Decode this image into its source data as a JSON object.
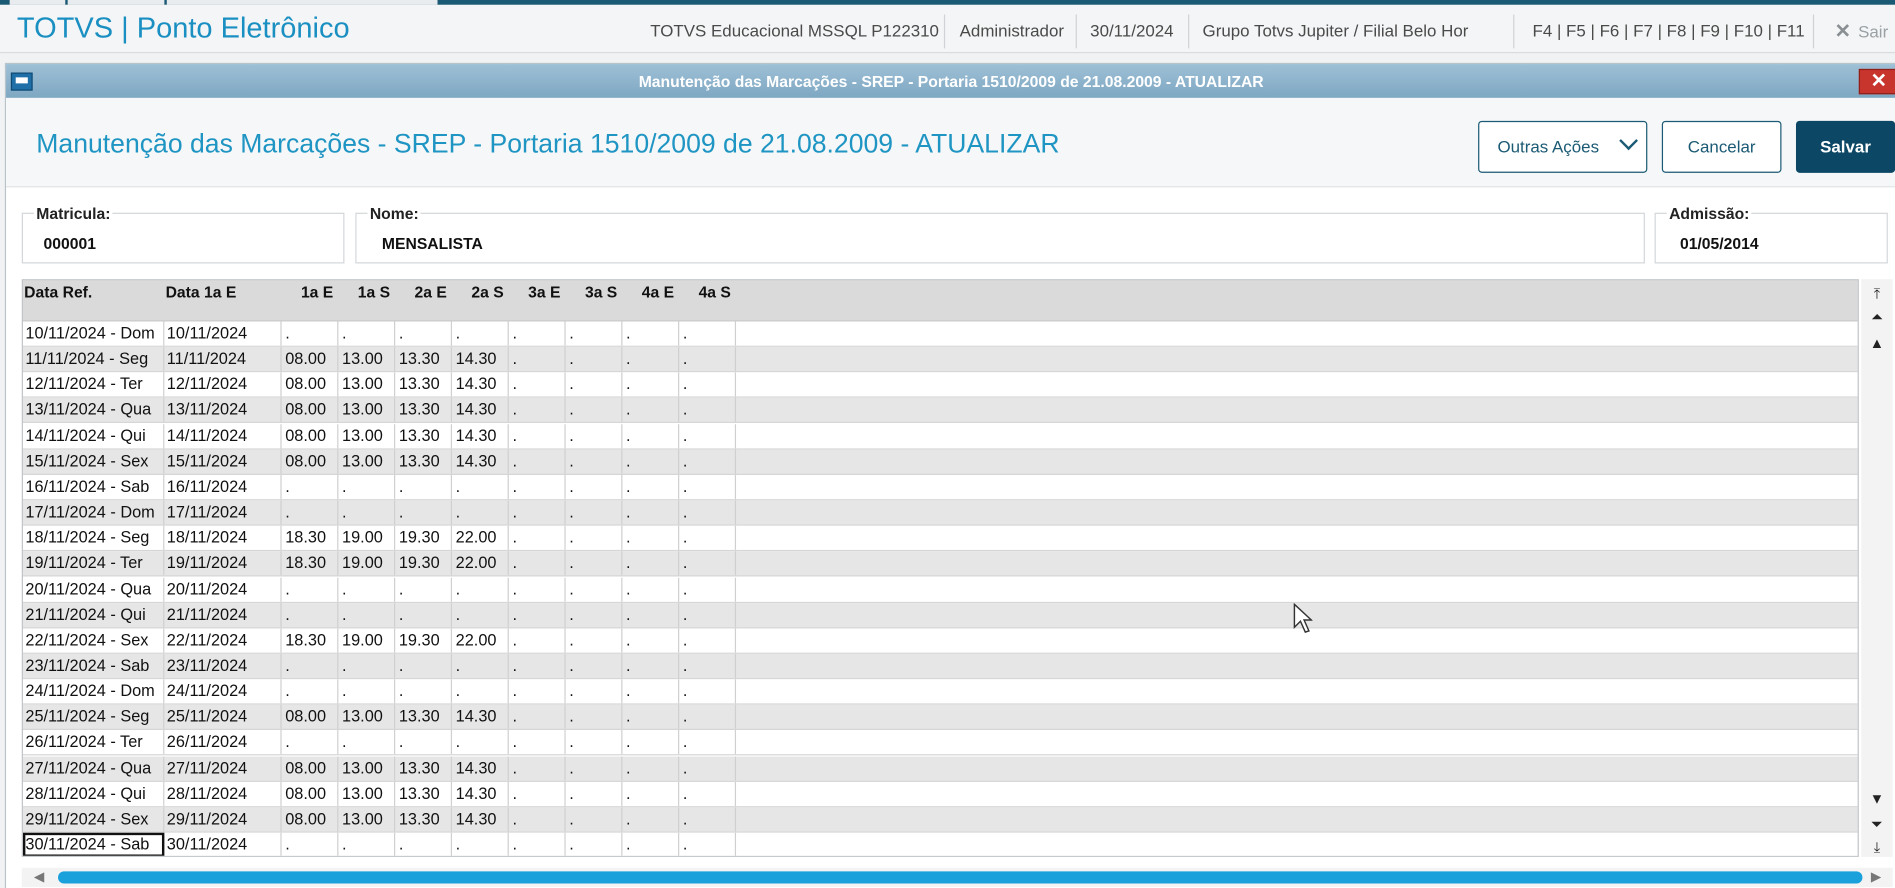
{
  "app": {
    "title": "TOTVS | Ponto Eletrônico",
    "environment": "TOTVS Educacional MSSQL P122310",
    "user": "Administrador",
    "date": "30/11/2024",
    "branch": "Grupo Totvs Jupiter / Filial Belo Hor",
    "shortcuts": "F4 | F5 | F6 | F7 | F8 | F9 | F10 | F11",
    "exit_label": "Sair"
  },
  "dialog": {
    "window_title": "Manutenção das Marcações - SREP - Portaria 1510/2009 de 21.08.2009 - ATUALIZAR",
    "page_title": "Manutenção das Marcações - SREP - Portaria 1510/2009 de 21.08.2009 - ATUALIZAR",
    "buttons": {
      "other_actions": "Outras Ações",
      "cancel": "Cancelar",
      "save": "Salvar"
    }
  },
  "form": {
    "matricula": {
      "label": "Matricula:",
      "value": "000001"
    },
    "nome": {
      "label": "Nome:",
      "value": "MENSALISTA"
    },
    "admissao": {
      "label": "Admissão:",
      "value": "01/05/2014"
    }
  },
  "grid": {
    "columns": [
      "Data Ref.",
      "Data 1a E",
      "1a E",
      "1a S",
      "2a E",
      "2a S",
      "3a E",
      "3a S",
      "4a E",
      "4a S"
    ],
    "rows": [
      [
        "10/11/2024 - Dom",
        "10/11/2024",
        ".",
        ".",
        ".",
        ".",
        ".",
        ".",
        ".",
        "."
      ],
      [
        "11/11/2024 - Seg",
        "11/11/2024",
        "08.00",
        "13.00",
        "13.30",
        "14.30",
        ".",
        ".",
        ".",
        "."
      ],
      [
        "12/11/2024 - Ter",
        "12/11/2024",
        "08.00",
        "13.00",
        "13.30",
        "14.30",
        ".",
        ".",
        ".",
        "."
      ],
      [
        "13/11/2024 - Qua",
        "13/11/2024",
        "08.00",
        "13.00",
        "13.30",
        "14.30",
        ".",
        ".",
        ".",
        "."
      ],
      [
        "14/11/2024 - Qui",
        "14/11/2024",
        "08.00",
        "13.00",
        "13.30",
        "14.30",
        ".",
        ".",
        ".",
        "."
      ],
      [
        "15/11/2024 - Sex",
        "15/11/2024",
        "08.00",
        "13.00",
        "13.30",
        "14.30",
        ".",
        ".",
        ".",
        "."
      ],
      [
        "16/11/2024 - Sab",
        "16/11/2024",
        ".",
        ".",
        ".",
        ".",
        ".",
        ".",
        ".",
        "."
      ],
      [
        "17/11/2024 - Dom",
        "17/11/2024",
        ".",
        ".",
        ".",
        ".",
        ".",
        ".",
        ".",
        "."
      ],
      [
        "18/11/2024 - Seg",
        "18/11/2024",
        "18.30",
        "19.00",
        "19.30",
        "22.00",
        ".",
        ".",
        ".",
        "."
      ],
      [
        "19/11/2024 - Ter",
        "19/11/2024",
        "18.30",
        "19.00",
        "19.30",
        "22.00",
        ".",
        ".",
        ".",
        "."
      ],
      [
        "20/11/2024 - Qua",
        "20/11/2024",
        ".",
        ".",
        ".",
        ".",
        ".",
        ".",
        ".",
        "."
      ],
      [
        "21/11/2024 - Qui",
        "21/11/2024",
        ".",
        ".",
        ".",
        ".",
        ".",
        ".",
        ".",
        "."
      ],
      [
        "22/11/2024 - Sex",
        "22/11/2024",
        "18.30",
        "19.00",
        "19.30",
        "22.00",
        ".",
        ".",
        ".",
        "."
      ],
      [
        "23/11/2024 - Sab",
        "23/11/2024",
        ".",
        ".",
        ".",
        ".",
        ".",
        ".",
        ".",
        "."
      ],
      [
        "24/11/2024 - Dom",
        "24/11/2024",
        ".",
        ".",
        ".",
        ".",
        ".",
        ".",
        ".",
        "."
      ],
      [
        "25/11/2024 - Seg",
        "25/11/2024",
        "08.00",
        "13.00",
        "13.30",
        "14.30",
        ".",
        ".",
        ".",
        "."
      ],
      [
        "26/11/2024 - Ter",
        "26/11/2024",
        ".",
        ".",
        ".",
        ".",
        ".",
        ".",
        ".",
        "."
      ],
      [
        "27/11/2024 - Qua",
        "27/11/2024",
        "08.00",
        "13.00",
        "13.30",
        "14.30",
        ".",
        ".",
        ".",
        "."
      ],
      [
        "28/11/2024 - Qui",
        "28/11/2024",
        "08.00",
        "13.00",
        "13.30",
        "14.30",
        ".",
        ".",
        ".",
        "."
      ],
      [
        "29/11/2024 - Sex",
        "29/11/2024",
        "08.00",
        "13.00",
        "13.30",
        "14.30",
        ".",
        ".",
        ".",
        "."
      ],
      [
        "30/11/2024 - Sab",
        "30/11/2024",
        ".",
        ".",
        ".",
        ".",
        ".",
        ".",
        ".",
        "."
      ]
    ],
    "selected_row": 20
  },
  "colors": {
    "accent": "#1a8fc2",
    "primary_button": "#0c4866",
    "titlebar": "#8fb3cb",
    "scroll_thumb": "#1aa1dc",
    "close_button": "#c8352d"
  },
  "icons": {
    "window_icon": "window-icon",
    "close": "close-icon",
    "exit": "close-icon",
    "dropdown": "chevron-down-icon",
    "scroll": [
      "scroll-top-icon",
      "scroll-page-up-icon",
      "scroll-up-icon",
      "scroll-down-icon",
      "scroll-page-down-icon",
      "scroll-bottom-icon"
    ]
  }
}
